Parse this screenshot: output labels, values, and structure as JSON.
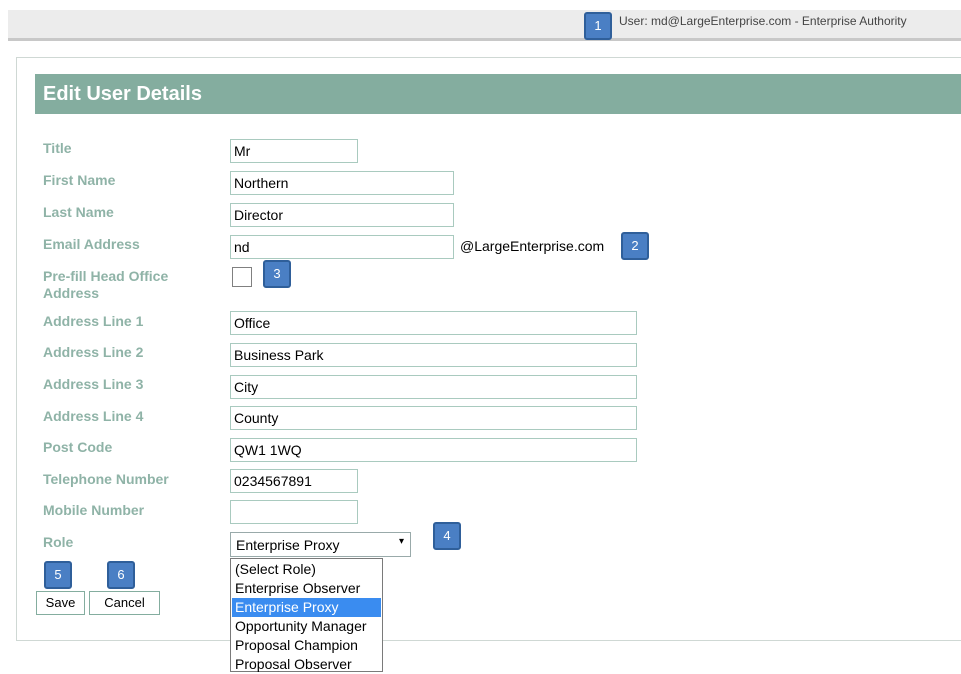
{
  "header": {
    "user_text": "User: md@LargeEnterprise.com - Enterprise Authority"
  },
  "form": {
    "title": "Edit User Details",
    "fields": {
      "title": {
        "label": "Title",
        "value": "Mr"
      },
      "first_name": {
        "label": "First Name",
        "value": "Northern"
      },
      "last_name": {
        "label": "Last Name",
        "value": "Director"
      },
      "email": {
        "label": "Email Address",
        "value": "nd",
        "domain": "@LargeEnterprise.com"
      },
      "prefill": {
        "label": "Pre-fill Head Office Address",
        "checked": false
      },
      "address1": {
        "label": "Address Line 1",
        "value": "Office"
      },
      "address2": {
        "label": "Address Line 2",
        "value": "Business Park"
      },
      "address3": {
        "label": "Address Line 3",
        "value": "City"
      },
      "address4": {
        "label": "Address Line 4",
        "value": "County"
      },
      "postcode": {
        "label": "Post Code",
        "value": "QW1 1WQ"
      },
      "telephone": {
        "label": "Telephone Number",
        "value": "0234567891"
      },
      "mobile": {
        "label": "Mobile Number",
        "value": ""
      },
      "role": {
        "label": "Role",
        "value": "Enterprise Proxy",
        "options": [
          "(Select Role)",
          "Enterprise Observer",
          "Enterprise Proxy",
          "Opportunity Manager",
          "Proposal Champion",
          "Proposal Observer"
        ],
        "selected_index": 2
      }
    },
    "buttons": {
      "save": "Save",
      "cancel": "Cancel"
    }
  },
  "annotations": [
    "1",
    "2",
    "3",
    "4",
    "5",
    "6"
  ],
  "colors": {
    "header_bg": "#84ad9f",
    "label": "#8fb3a7",
    "badge": "#4a7fc4",
    "selected_option": "#3a8cf0"
  }
}
